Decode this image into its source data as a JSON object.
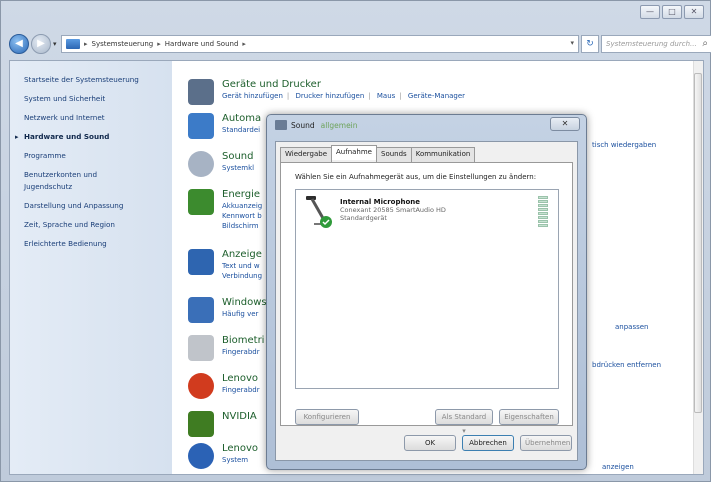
{
  "window": {
    "buttons": [
      "—",
      "□",
      "✕"
    ]
  },
  "nav": {
    "back": "◀",
    "forward": "▶",
    "dropdown": "▾",
    "breadcrumb": [
      "Systemsteuerung",
      "Hardware und Sound"
    ],
    "arrow": "▸",
    "refresh": "↻",
    "search_placeholder": "Systemsteuerung durch...",
    "search_icon": "⌕"
  },
  "sidebar": {
    "items": [
      "Startseite der Systemsteuerung",
      "System und Sicherheit",
      "Netzwerk und Internet",
      "Hardware und Sound",
      "Programme",
      "Benutzerkonten und",
      "Jugendschutz",
      "Darstellung und Anpassung",
      "Zeit, Sprache und Region",
      "Erleichterte Bedienung"
    ]
  },
  "categories": [
    {
      "title": "Geräte und Drucker",
      "links": [
        "Gerät hinzufügen",
        "Drucker hinzufügen",
        "Maus",
        "Geräte-Manager"
      ],
      "color": "#5b6f8a"
    },
    {
      "title": "Automa",
      "links": [
        "Standardei"
      ],
      "color": "#3c7bc8"
    },
    {
      "title": "Sound",
      "links": [
        "Systemkl"
      ],
      "color": "#a7b3c4"
    },
    {
      "title": "Energie",
      "links": [
        "Akkuanzeig",
        "Kennwort b",
        "Bildschirm"
      ],
      "color": "#3c8b2e"
    },
    {
      "title": "Anzeige",
      "links": [
        "Text und w",
        "Verbindung"
      ],
      "color": "#2e65b0"
    },
    {
      "title": "Windows",
      "links": [
        "Häufig ver"
      ],
      "color": "#3a6fb8"
    },
    {
      "title": "Biometri",
      "links": [
        "Fingerabdr"
      ],
      "color": "#c0c4ca"
    },
    {
      "title": "Lenovo",
      "links": [
        "Fingerabdr"
      ],
      "color": "#d13b1e"
    },
    {
      "title": "NVIDIA",
      "links": [],
      "color": "#3f7c22"
    },
    {
      "title": "Lenovo",
      "links": [
        "System"
      ],
      "color": "#2b62b5"
    }
  ],
  "right_links": [
    "tisch wiedergaben",
    "anpassen",
    "bdrücken entfernen",
    "anzeigen"
  ],
  "dialog": {
    "title": "Sound",
    "title_blur": "allgemein",
    "close": "✕",
    "tabs": [
      "Wiedergabe",
      "Aufnahme",
      "Sounds",
      "Kommunikation"
    ],
    "active_tab": 1,
    "instruction": "Wählen Sie ein Aufnahmegerät aus, um die Einstellungen zu ändern:",
    "device": {
      "name": "Internal Microphone",
      "driver": "Conexant 20585 SmartAudio HD",
      "status": "Standardgerät"
    },
    "buttons": {
      "configure": "Konfigurieren",
      "set_default": "Als Standard",
      "default_arrow": "▾",
      "properties": "Eigenschaften",
      "ok": "OK",
      "cancel": "Abbrechen",
      "apply": "Übernehmen"
    }
  }
}
